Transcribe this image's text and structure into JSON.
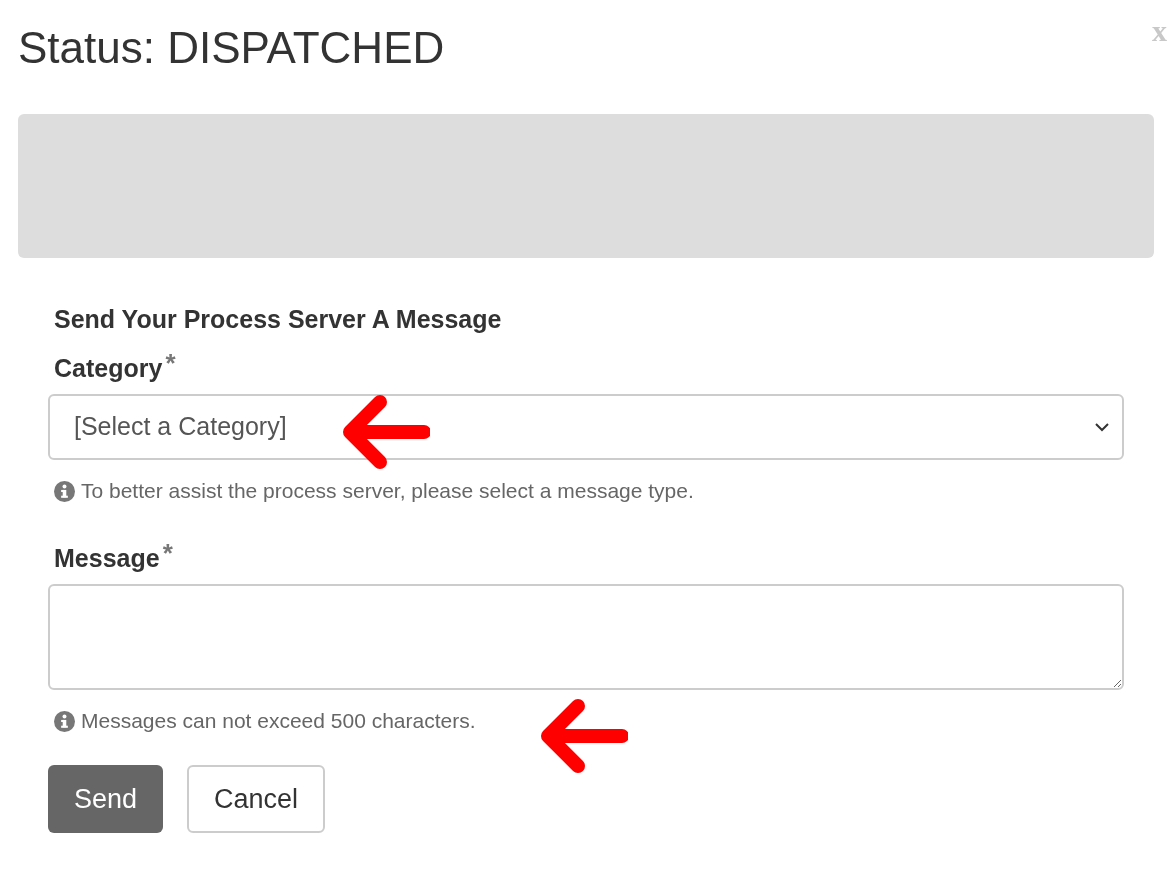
{
  "dialog": {
    "title": "Status: DISPATCHED",
    "close": "x"
  },
  "form": {
    "heading": "Send Your Process Server A Message",
    "fields": [
      {
        "kind": "select",
        "label": "Category",
        "required_mark": "*",
        "value": "[Select a Category]",
        "help": "To better assist the process server, please select a message type.",
        "annotated": true
      },
      {
        "kind": "textarea",
        "label": "Message",
        "required_mark": "*",
        "help": "Messages can not exceed 500 characters.",
        "annotated": true
      }
    ],
    "buttons": [
      {
        "label": "Send",
        "primary": true
      },
      {
        "label": "Cancel",
        "primary": false
      }
    ]
  }
}
